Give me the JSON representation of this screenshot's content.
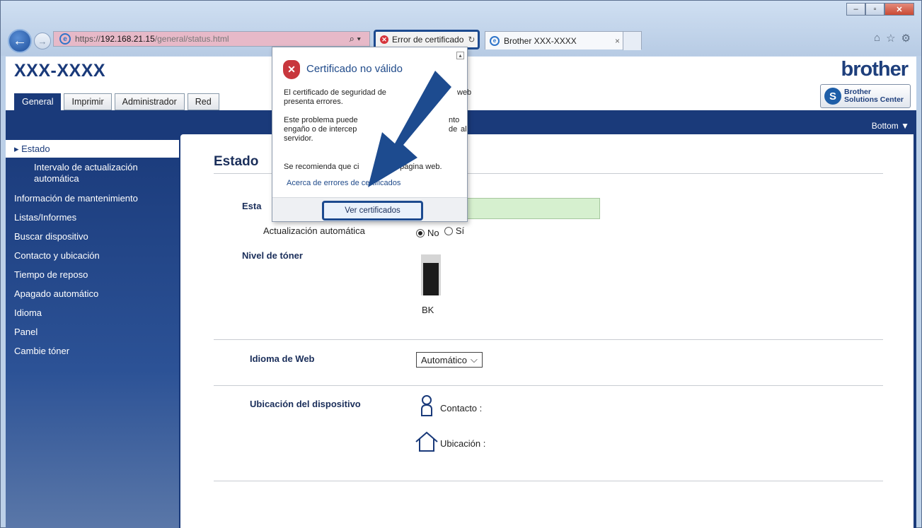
{
  "browser": {
    "url_prefix": "https://",
    "url_host": "192.168.21.15",
    "url_path": "/general/status.html",
    "cert_error_label": "Error de certificado",
    "tab_title": "Brother XXX-XXXX",
    "tab_close": "×"
  },
  "page": {
    "model": "XXX-XXXX",
    "brand": "brother",
    "tabs": [
      "General",
      "Imprimir",
      "Administrador",
      "Red"
    ],
    "solutions_line1": "Brother",
    "solutions_line2": "Solutions Center",
    "bottom_link": "Bottom ▼"
  },
  "sidebar": {
    "items": [
      {
        "label": "▸ Estado"
      },
      {
        "label": "Intervalo de actualización automática"
      },
      {
        "label": "Información de mantenimiento"
      },
      {
        "label": "Listas/Informes"
      },
      {
        "label": "Buscar dispositivo"
      },
      {
        "label": "Contacto y ubicación"
      },
      {
        "label": "Tiempo de reposo"
      },
      {
        "label": "Apagado automático"
      },
      {
        "label": "Idioma"
      },
      {
        "label": "Panel"
      },
      {
        "label": "Cambie tóner"
      }
    ]
  },
  "content": {
    "title": "Estado",
    "status_label": "Esta",
    "auto_update_label": "Actualización automática",
    "radio_no": "No",
    "radio_yes": "Sí",
    "toner_label": "Nivel de tóner",
    "toner_color": "BK",
    "toner_level": 0.8,
    "web_lang_label": "Idioma de Web",
    "web_lang_value": "Automático",
    "location_label": "Ubicación del dispositivo",
    "contact": "Contacto :",
    "location": "Ubicación :"
  },
  "popup": {
    "title": "Certificado no válido",
    "p1_line1": "El certificado de seguridad de",
    "p1_line1_end": "web",
    "p1_line2": "presenta errores.",
    "p2_line1": "Este problema puede",
    "p2_line1_end": "nto de",
    "p2_line2": "engaño o de intercep",
    "p2_line2_end": "al",
    "p2_line3": "servidor.",
    "p3_start": "Se recomienda que ci",
    "p3_end": "a página web.",
    "link": "Acerca de errores de certificados",
    "button": "Ver certificados"
  },
  "colors": {
    "nav_blue": "#1a3a7a",
    "highlight": "#1c4a8f",
    "address_error": "#e7b9c8",
    "status_green": "#d6f0cf"
  }
}
